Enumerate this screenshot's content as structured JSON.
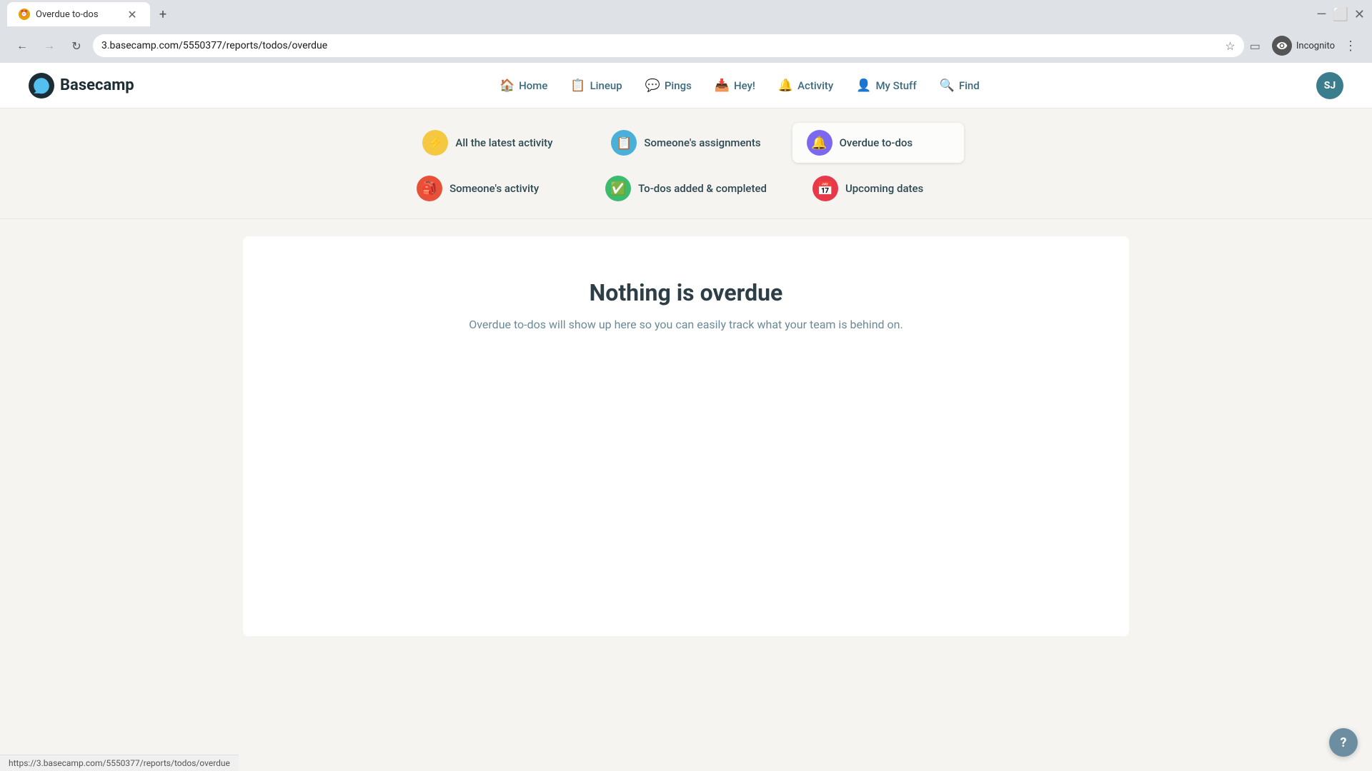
{
  "browser": {
    "tab_title": "Overdue to-dos",
    "tab_favicon": "⏰",
    "url": "3.basecamp.com/5550377/reports/todos/overdue",
    "new_tab_icon": "+",
    "back_disabled": false,
    "forward_disabled": true,
    "incognito_label": "Incognito",
    "more_icon": "⋮",
    "status_bar_url": "https://3.basecamp.com/5550377/reports/todos/overdue"
  },
  "header": {
    "logo_text": "Basecamp",
    "nav_items": [
      {
        "id": "home",
        "label": "Home",
        "icon": "🏠"
      },
      {
        "id": "lineup",
        "label": "Lineup",
        "icon": "📋"
      },
      {
        "id": "pings",
        "label": "Pings",
        "icon": "💬"
      },
      {
        "id": "hey",
        "label": "Hey!",
        "icon": "📥"
      },
      {
        "id": "activity",
        "label": "Activity",
        "icon": "🔔"
      },
      {
        "id": "mystuff",
        "label": "My Stuff",
        "icon": "👤"
      },
      {
        "id": "find",
        "label": "Find",
        "icon": "🔍"
      }
    ],
    "user_initials": "SJ"
  },
  "activity_dropdown": {
    "items": [
      {
        "id": "all-latest-activity",
        "label": "All the latest activity",
        "icon": "⚡",
        "icon_class": "icon-yellow"
      },
      {
        "id": "someones-activity",
        "label": "Someone's activity",
        "icon": "🎒",
        "icon_class": "icon-red"
      },
      {
        "id": "someones-assignments",
        "label": "Someone's assignments",
        "icon": "📋",
        "icon_class": "icon-blue"
      },
      {
        "id": "todos-added-completed",
        "label": "To-dos added & completed",
        "icon": "✅",
        "icon_class": "icon-green"
      },
      {
        "id": "overdue-todos",
        "label": "Overdue to-dos",
        "icon": "🔔",
        "icon_class": "icon-purple",
        "active": true
      },
      {
        "id": "upcoming-dates",
        "label": "Upcoming dates",
        "icon": "📅",
        "icon_class": "icon-pink"
      }
    ]
  },
  "main": {
    "nothing_title": "Nothing is overdue",
    "nothing_desc": "Overdue to-dos will show up here so you can easily track what your team is behind on."
  },
  "help_button_label": "?",
  "status_url": "https://3.basecamp.com/5550377/reports/todos/overdue"
}
